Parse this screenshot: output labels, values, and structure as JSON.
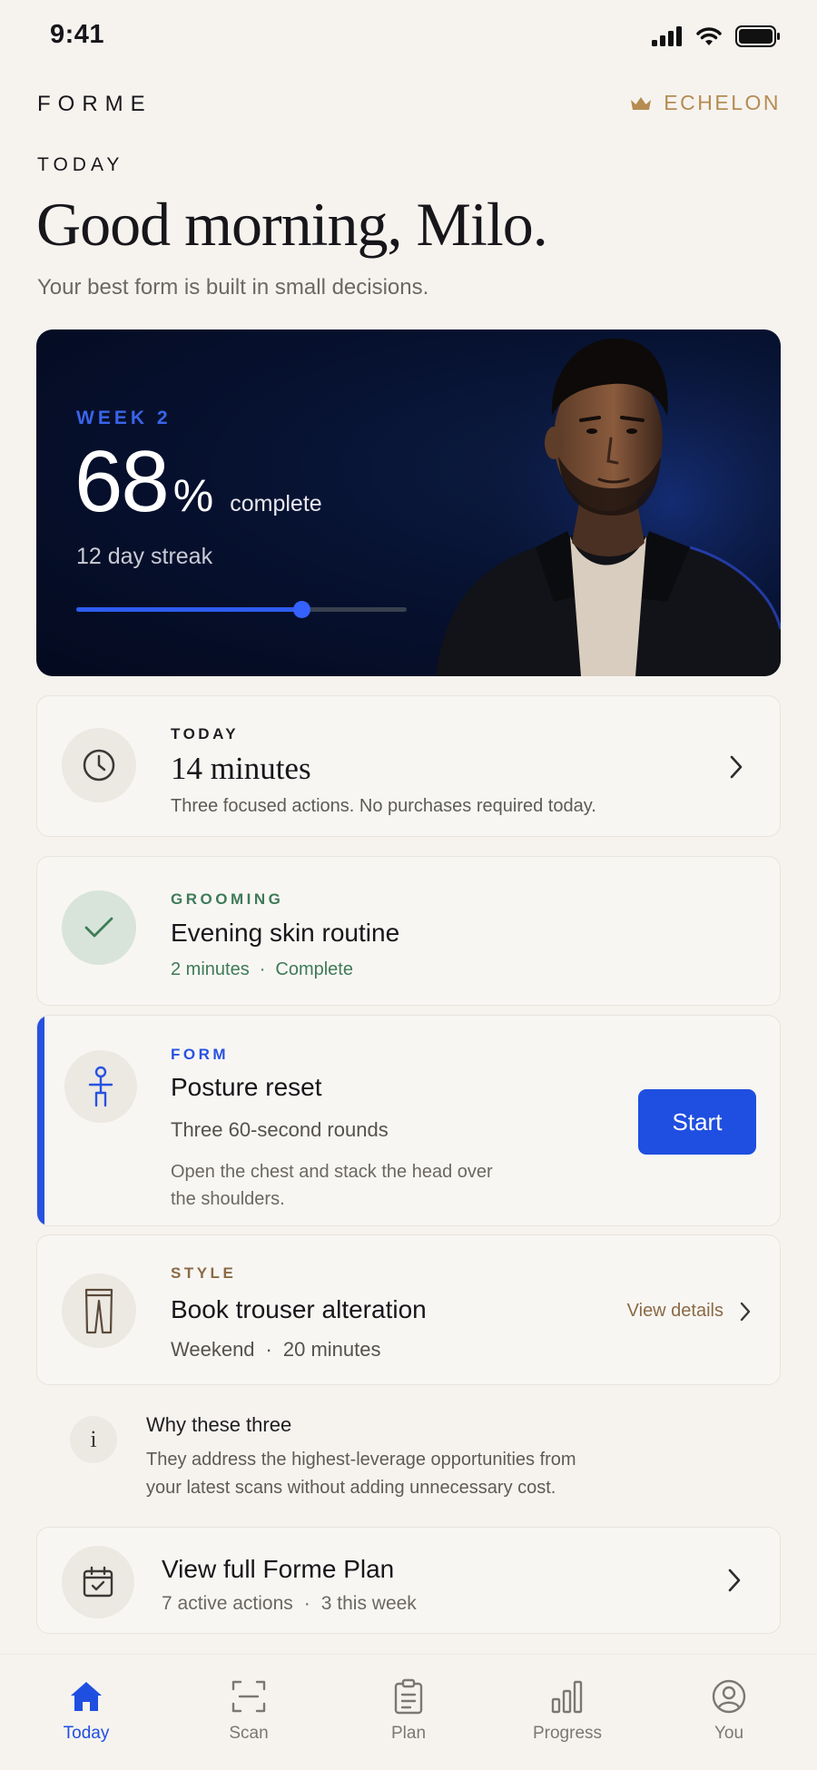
{
  "status_bar": {
    "time": "9:41"
  },
  "header": {
    "brand": "FORME",
    "membership": "ECHELON"
  },
  "intro": {
    "eyebrow": "TODAY",
    "greeting": "Good morning, Milo.",
    "tagline": "Your best form is built in small decisions."
  },
  "hero": {
    "week": "WEEK 2",
    "percent": "68",
    "percent_sign": "%",
    "complete_label": "complete",
    "streak": "12 day streak",
    "progress": 0.68
  },
  "today_card": {
    "eyebrow": "TODAY",
    "title": "14 minutes",
    "subtitle": "Three focused actions. No purchases required today."
  },
  "grooming_card": {
    "eyebrow": "GROOMING",
    "title": "Evening skin routine",
    "duration": "2 minutes",
    "separator": "·",
    "status": "Complete"
  },
  "form_card": {
    "eyebrow": "FORM",
    "title": "Posture reset",
    "subtitle": "Three 60-second rounds",
    "desc_line1": "Open the chest and stack the head over",
    "desc_line2": "the shoulders.",
    "cta": "Start"
  },
  "style_card": {
    "eyebrow": "STYLE",
    "title": "Book trouser alteration",
    "when": "Weekend",
    "separator": "·",
    "duration": "20 minutes",
    "link": "View details"
  },
  "why": {
    "title": "Why these three",
    "line1": "They address the highest-leverage opportunities from",
    "line2": "your latest scans without adding unnecessary cost."
  },
  "plan_card": {
    "title": "View full Forme Plan",
    "active": "7 active actions",
    "separator": "·",
    "week": "3 this week"
  },
  "tabs": [
    {
      "label": "Today",
      "icon": "home-icon",
      "active": true
    },
    {
      "label": "Scan",
      "icon": "scan-icon",
      "active": false
    },
    {
      "label": "Plan",
      "icon": "clipboard-icon",
      "active": false
    },
    {
      "label": "Progress",
      "icon": "bar-chart-icon",
      "active": false
    },
    {
      "label": "You",
      "icon": "user-icon",
      "active": false
    }
  ],
  "colors": {
    "accent": "#1f4fe0",
    "gold": "#b58c52",
    "success": "#3e7b57",
    "style_brown": "#8a6a45",
    "background": "#f6f3ef",
    "hero_bg": "#061029"
  }
}
